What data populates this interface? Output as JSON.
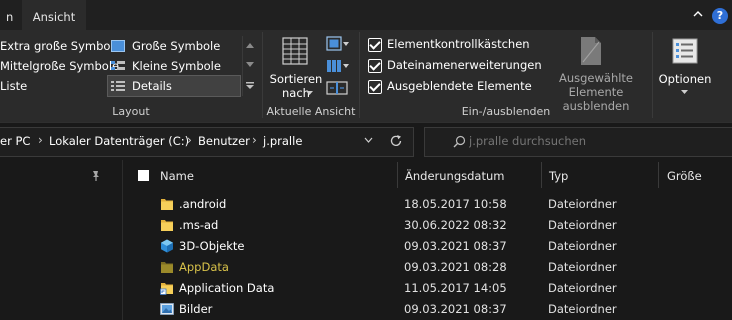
{
  "tabs": {
    "file_partial": "n",
    "view": "Ansicht"
  },
  "ribbon": {
    "layout": {
      "items": [
        "Extra große Symbole",
        "Große Symbole",
        "Mittelgroße Symbole",
        "Kleine Symbole",
        "Liste",
        "Details"
      ],
      "group_label": "Layout"
    },
    "current_view": {
      "sort_label_line1": "Sortieren",
      "sort_label_line2": "nach",
      "group_label": "Aktuelle Ansicht"
    },
    "show_hide": {
      "checkboxes": [
        {
          "label": "Elementkontrollkästchen",
          "checked": true
        },
        {
          "label": "Dateinamenerweiterungen",
          "checked": true
        },
        {
          "label": "Ausgeblendete Elemente",
          "checked": true
        }
      ],
      "hide_selected_line1": "Ausgewählte",
      "hide_selected_line2": "Elemente ausblenden",
      "group_label": "Ein-/ausblenden"
    },
    "options_label": "Optionen"
  },
  "address": {
    "crumbs": [
      "er PC",
      "Lokaler Datenträger (C:)",
      "Benutzer",
      "j.pralle"
    ],
    "separator": "›"
  },
  "search": {
    "placeholder": "j.pralle durchsuchen"
  },
  "columns": {
    "name": "Name",
    "date": "Änderungsdatum",
    "type": "Typ",
    "size": "Größe"
  },
  "files": [
    {
      "name": ".android",
      "date": "18.05.2017 10:58",
      "type": "Dateiordner",
      "icon": "folder-icon"
    },
    {
      "name": ".ms-ad",
      "date": "30.06.2022 08:32",
      "type": "Dateiordner",
      "icon": "folder-icon"
    },
    {
      "name": "3D-Objekte",
      "date": "09.03.2021 08:37",
      "type": "Dateiordner",
      "icon": "3d-objects-icon"
    },
    {
      "name": "AppData",
      "date": "09.03.2021 08:28",
      "type": "Dateiordner",
      "icon": "hidden-folder-icon"
    },
    {
      "name": "Application Data",
      "date": "11.05.2017 14:05",
      "type": "Dateiordner",
      "icon": "shortcut-folder-icon"
    },
    {
      "name": "Bilder",
      "date": "09.03.2021 08:37",
      "type": "Dateiordner",
      "icon": "pictures-icon"
    }
  ],
  "colors": {
    "background": "#191919",
    "ribbon": "#2b2b2b",
    "folder": "#f0c340",
    "hidden_folder": "#9b8a2a",
    "hidden_name": "#d8c24a"
  }
}
